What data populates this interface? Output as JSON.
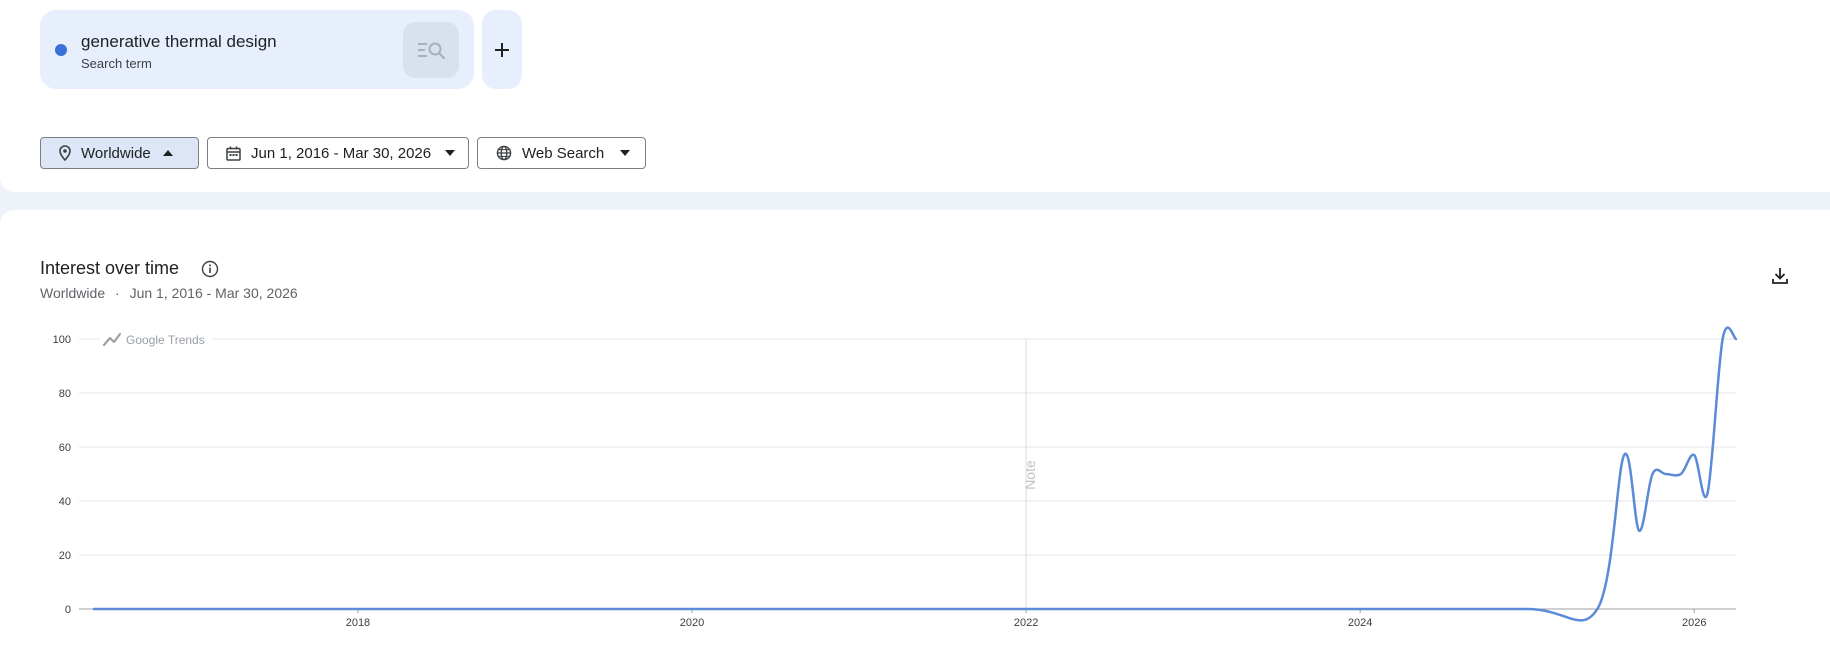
{
  "search_term": {
    "name": "generative thermal design",
    "type": "Search term",
    "color": "#3b6fd9"
  },
  "add_button_icon": "plus-icon",
  "filters": {
    "location": "Worldwide",
    "date_range": "Jun 1, 2016 - Mar 30, 2026",
    "search_type": "Web Search"
  },
  "section": {
    "title": "Interest over time",
    "subtitle_location": "Worldwide",
    "subtitle_separator": "·",
    "subtitle_range": "Jun 1, 2016 - Mar 30, 2026"
  },
  "chart_data": {
    "type": "line",
    "watermark": "Google Trends",
    "note_label": "Note",
    "note_at": 2022.0,
    "xlim": [
      2016.33,
      2026.25
    ],
    "ylim": [
      0,
      100
    ],
    "x_ticks": [
      "2018",
      "2020",
      "2022",
      "2024",
      "2026"
    ],
    "y_ticks": [
      "0",
      "20",
      "40",
      "60",
      "80",
      "100"
    ],
    "grid": true,
    "line_color": "#5b8ad6",
    "series": [
      {
        "x": [
          2016.42,
          2017.0,
          2018.0,
          2019.0,
          2020.0,
          2021.0,
          2022.0,
          2023.0,
          2024.0,
          2025.0,
          2025.42,
          2025.58,
          2025.67,
          2025.75,
          2025.83,
          2025.92,
          2026.0,
          2026.08,
          2026.17,
          2026.25
        ],
        "y": [
          0,
          0,
          0,
          0,
          0,
          0,
          0,
          0,
          0,
          0,
          0,
          57,
          29,
          50,
          50,
          50,
          57,
          43,
          100,
          100
        ]
      }
    ]
  }
}
